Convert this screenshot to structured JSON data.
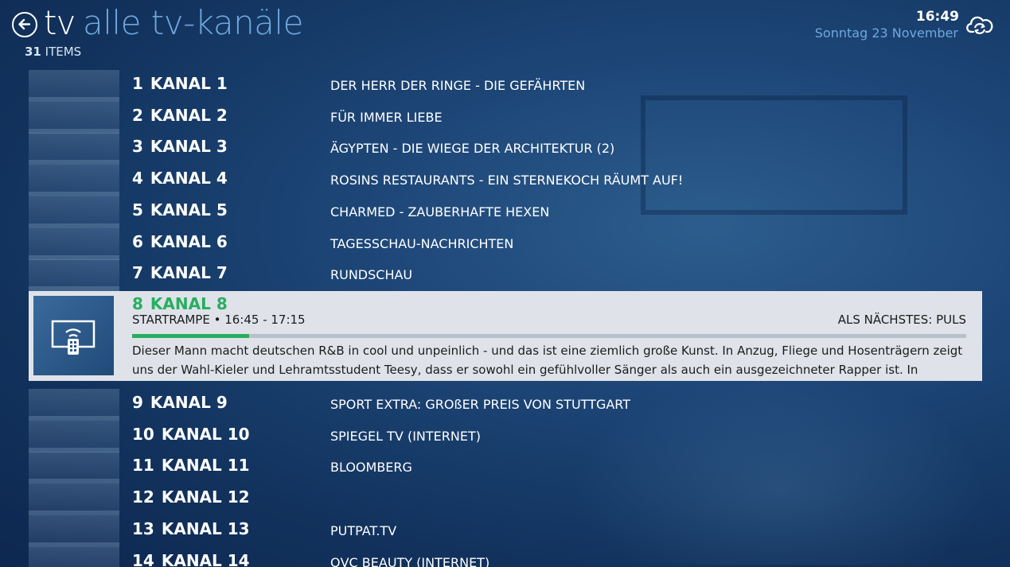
{
  "header": {
    "title_main": "tv",
    "title_sub": "alle tv-kanäle",
    "items_count": "31",
    "items_label": "ITEMS",
    "time": "16:49",
    "date": "Sonntag 23 November"
  },
  "channels_above": [
    {
      "num": "1",
      "name": "KANAL 1",
      "program": "DER HERR DER RINGE - DIE GEFÄHRTEN"
    },
    {
      "num": "2",
      "name": "KANAL 2",
      "program": "FÜR IMMER LIEBE"
    },
    {
      "num": "3",
      "name": "KANAL 3",
      "program": "ÄGYPTEN - DIE WIEGE DER ARCHITEKTUR (2)"
    },
    {
      "num": "4",
      "name": "KANAL 4",
      "program": "ROSINS RESTAURANTS - EIN STERNEKOCH RÄUMT AUF!"
    },
    {
      "num": "5",
      "name": "KANAL 5",
      "program": "CHARMED - ZAUBERHAFTE HEXEN"
    },
    {
      "num": "6",
      "name": "KANAL 6",
      "program": "TAGESSCHAU-NACHRICHTEN"
    },
    {
      "num": "7",
      "name": "KANAL 7",
      "program": "RUNDSCHAU"
    }
  ],
  "selected": {
    "num": "8",
    "name": "KANAL 8",
    "show": "STARTRAMPE • 16:45 - 17:15",
    "next": "ALS NÄCHSTES: PULS",
    "progress": 0.14,
    "description": "Dieser Mann macht deutschen R&B in cool und unpeinlich - und das ist eine ziemlich große Kunst. In Anzug, Fliege und Hosenträgern zeigt uns der Wahl-Kieler und Lehramtsstudent Teesy, dass er sowohl ein gefühlvoller Sänger als auch ein ausgezeichneter Rapper ist. In"
  },
  "channels_below": [
    {
      "num": "9",
      "name": "KANAL 9",
      "program": "SPORT EXTRA: GROßER PREIS VON STUTTGART"
    },
    {
      "num": "10",
      "name": "KANAL 10",
      "program": "SPIEGEL TV (INTERNET)"
    },
    {
      "num": "11",
      "name": "KANAL 11",
      "program": "BLOOMBERG"
    },
    {
      "num": "12",
      "name": "KANAL 12",
      "program": ""
    },
    {
      "num": "13",
      "name": "KANAL 13",
      "program": "PUTPAT.TV"
    },
    {
      "num": "14",
      "name": "KANAL 14",
      "program": "QVC BEAUTY (INTERNET)"
    }
  ],
  "colors": {
    "accent_green": "#27ae60",
    "title_blue": "#6fa8dc"
  },
  "icons": {
    "back": "back-arrow-circle-icon",
    "sync": "cloud-sync-icon",
    "tv_remote": "tv-remote-icon"
  }
}
